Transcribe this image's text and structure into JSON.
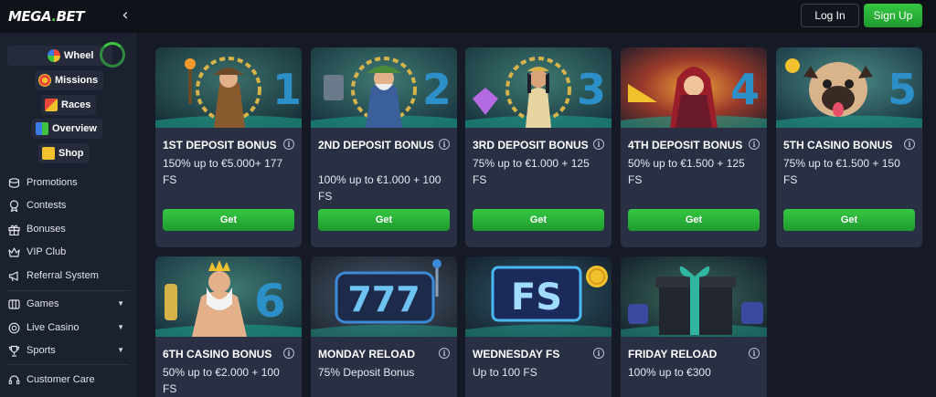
{
  "header": {
    "logo_main": "MEGA",
    "logo_dot": ".",
    "logo_end": "BET",
    "collapse_icon": "‹",
    "login_label": "Log In",
    "signup_label": "Sign Up"
  },
  "sidebar": {
    "featured": [
      {
        "key": "wheel",
        "label": "Wheel",
        "icon": "wheel-icon"
      },
      {
        "key": "missions",
        "label": "Missions",
        "icon": "target-icon"
      },
      {
        "key": "races",
        "label": "Races",
        "icon": "flag-icon"
      },
      {
        "key": "overview",
        "label": "Overview",
        "icon": "grid-icon"
      },
      {
        "key": "shop",
        "label": "Shop",
        "icon": "cart-icon"
      }
    ],
    "menu": [
      {
        "label": "Promotions",
        "icon": "coins-icon"
      },
      {
        "label": "Contests",
        "icon": "trophy-icon"
      },
      {
        "label": "Bonuses",
        "icon": "gift-icon"
      },
      {
        "label": "VIP Club",
        "icon": "crown-icon"
      },
      {
        "label": "Referral System",
        "icon": "megaphone-icon"
      }
    ],
    "menu2": [
      {
        "label": "Games",
        "icon": "games-icon",
        "expandable": true
      },
      {
        "label": "Live Casino",
        "icon": "chip-icon",
        "expandable": true
      },
      {
        "label": "Sports",
        "icon": "trophy-icon",
        "expandable": true
      }
    ],
    "support": {
      "label": "Customer Care",
      "icon": "headset-icon"
    }
  },
  "cards": [
    {
      "title": "1st Deposit Bonus",
      "desc": "150% up to €5.000+ 177 FS",
      "button": "Get",
      "info": "i",
      "number": "1"
    },
    {
      "title": "2nd Deposit Bonus",
      "desc": "100% up to €1.000 + 100 FS",
      "button": "Get",
      "info": "i",
      "number": "2"
    },
    {
      "title": "3rd Deposit Bonus",
      "desc": "75% up to €1.000 + 125 FS",
      "button": "Get",
      "info": "i",
      "number": "3"
    },
    {
      "title": "4th Deposit Bonus",
      "desc": "50% up to €1.500 + 125 FS",
      "button": "Get",
      "info": "i",
      "number": "4"
    },
    {
      "title": "5th Casino Bonus",
      "desc": "75% up to €1.500 + 150 FS",
      "button": "Get",
      "info": "i",
      "number": "5"
    },
    {
      "title": "6th Casino Bonus",
      "desc": "50% up to €2.000 + 100 FS",
      "info": "i",
      "number": "6"
    },
    {
      "title": "Monday Reload",
      "desc": "75% Deposit Bonus",
      "info": "i",
      "art_text": "777"
    },
    {
      "title": "Wednesday FS",
      "desc": "Up to 100 FS",
      "info": "i",
      "art_text": "FS"
    },
    {
      "title": "Friday Reload",
      "desc": "100% up to €300",
      "info": "i"
    }
  ],
  "colors": {
    "accent_green": "#2fb53a",
    "page_bg": "#161a26",
    "card_bg": "#2a3044",
    "sidebar_bg": "#1c2130"
  }
}
